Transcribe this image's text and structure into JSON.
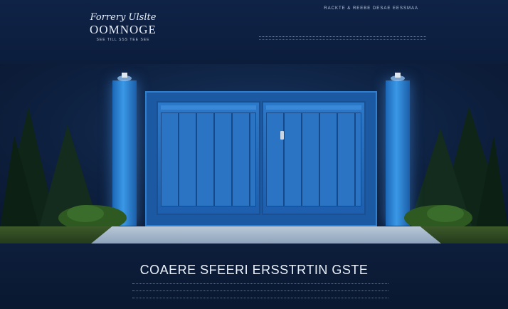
{
  "brand": {
    "script_line": "Forrery Ulslte",
    "name": "OOMNOGE",
    "tagline": "SEE TILL SSS  TEE SEE"
  },
  "header": {
    "top_link": "RACKTE & REEBE DESAE EESSMAA"
  },
  "footer": {
    "title": "COAERE SFEERI ERSSTRTIN GSTE"
  },
  "colors": {
    "accent": "#2f7fd0",
    "background": "#0b1a33"
  }
}
